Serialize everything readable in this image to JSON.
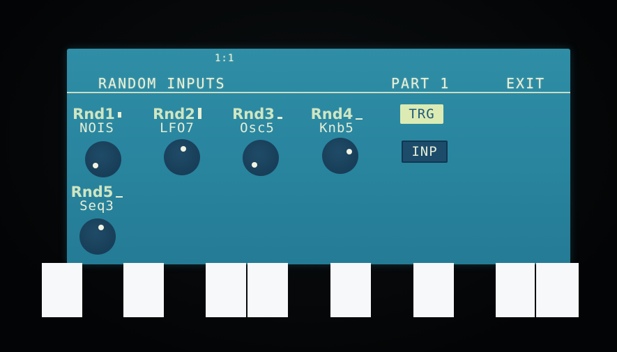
{
  "header": {
    "page_number": "1:1",
    "title": "RANDOM INPUTS",
    "part": "PART 1",
    "exit": "EXIT"
  },
  "params": [
    {
      "label": "Rnd1",
      "value": "NOIS",
      "indicator": "mid",
      "knob_dot": "lower-left"
    },
    {
      "label": "Rnd2",
      "value": "LFO7",
      "indicator": "tall",
      "knob_dot": "top"
    },
    {
      "label": "Rnd3",
      "value": "Osc5",
      "indicator": "low",
      "knob_dot": "lower-left"
    },
    {
      "label": "Rnd4",
      "value": "Knb5",
      "indicator": "line",
      "knob_dot": "right"
    },
    {
      "label": "Rnd5",
      "value": "Seq3",
      "indicator": "line",
      "knob_dot": "top"
    }
  ],
  "buttons": {
    "trg": "TRG",
    "inp": "INP"
  },
  "colors": {
    "screen": "#2a86a0",
    "text": "#e9f1d8",
    "knob": "#183e58",
    "trg_bg": "#dcebb4"
  }
}
